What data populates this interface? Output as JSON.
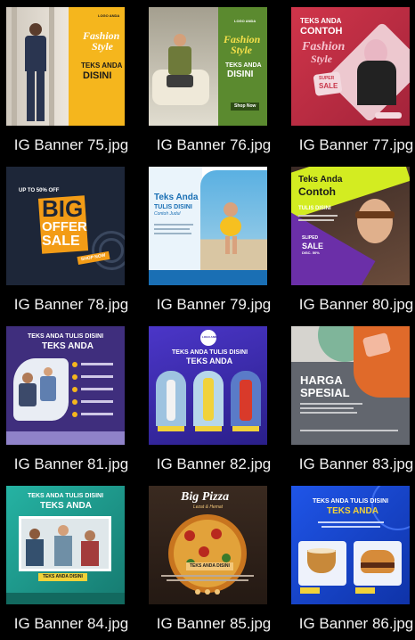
{
  "files": [
    {
      "name": "IG Banner 75.jpg"
    },
    {
      "name": "IG Banner 76.jpg"
    },
    {
      "name": "IG Banner 77.jpg"
    },
    {
      "name": "IG Banner 78.jpg"
    },
    {
      "name": "IG Banner 79.jpg"
    },
    {
      "name": "IG Banner 80.jpg"
    },
    {
      "name": "IG Banner 81.jpg"
    },
    {
      "name": "IG Banner 82.jpg"
    },
    {
      "name": "IG Banner 83.jpg"
    },
    {
      "name": "IG Banner 84.jpg"
    },
    {
      "name": "IG Banner 85.jpg"
    },
    {
      "name": "IG Banner 86.jpg"
    }
  ],
  "thumbs": {
    "t75": {
      "fashion": "Fashion",
      "style": "Style",
      "teks": "TEKS ANDA",
      "disini": "DISINI",
      "logo": "LOGO ANDA"
    },
    "t76": {
      "fashion": "Fashion",
      "style": "Style",
      "teks": "TEKS ANDA",
      "disini": "DISINI",
      "logo": "LOGO ANDA",
      "btn": "Shop Now"
    },
    "t77": {
      "teks": "TEKS ANDA",
      "contoh": "CONTOH",
      "fashion": "Fashion",
      "style": "Style",
      "super": "SUPER",
      "sale": "SALE"
    },
    "t78": {
      "upto": "UP TO 50% OFF",
      "big": "BIG",
      "offer": "OFFER",
      "sale": "SALE",
      "btn": "SHOP NOW"
    },
    "t79": {
      "teks": "Teks Anda",
      "tulis": "TULIS DISINI",
      "contoh": "Contoh Judul"
    },
    "t80": {
      "teks": "Teks Anda",
      "contoh": "Contoh",
      "tulis": "TULIS DISINI",
      "sliped": "SLIPED",
      "sale": "SALE",
      "disc": "DISC. 50%"
    },
    "t81": {
      "title1": "TEKS ANDA TULIS DISINI",
      "title2": "TEKS ANDA"
    },
    "t82": {
      "logo": "LOGO ANDA",
      "title1": "TEKS ANDA TULIS DISINI",
      "title2": "TEKS ANDA"
    },
    "t83": {
      "harga": "HARGA",
      "spesial": "SPESIAL"
    },
    "t84": {
      "title1": "TEKS ANDA TULIS DISINI",
      "title2": "TEKS ANDA",
      "btn": "TEKS ANDA DISINI"
    },
    "t85": {
      "big": "Big Pizza",
      "sub": "Lezat & Hemat",
      "band": "TEKS ANDA DISINI"
    },
    "t86": {
      "title1": "TEKS ANDA TULIS DISINI",
      "title2": "TEKS ANDA"
    }
  }
}
